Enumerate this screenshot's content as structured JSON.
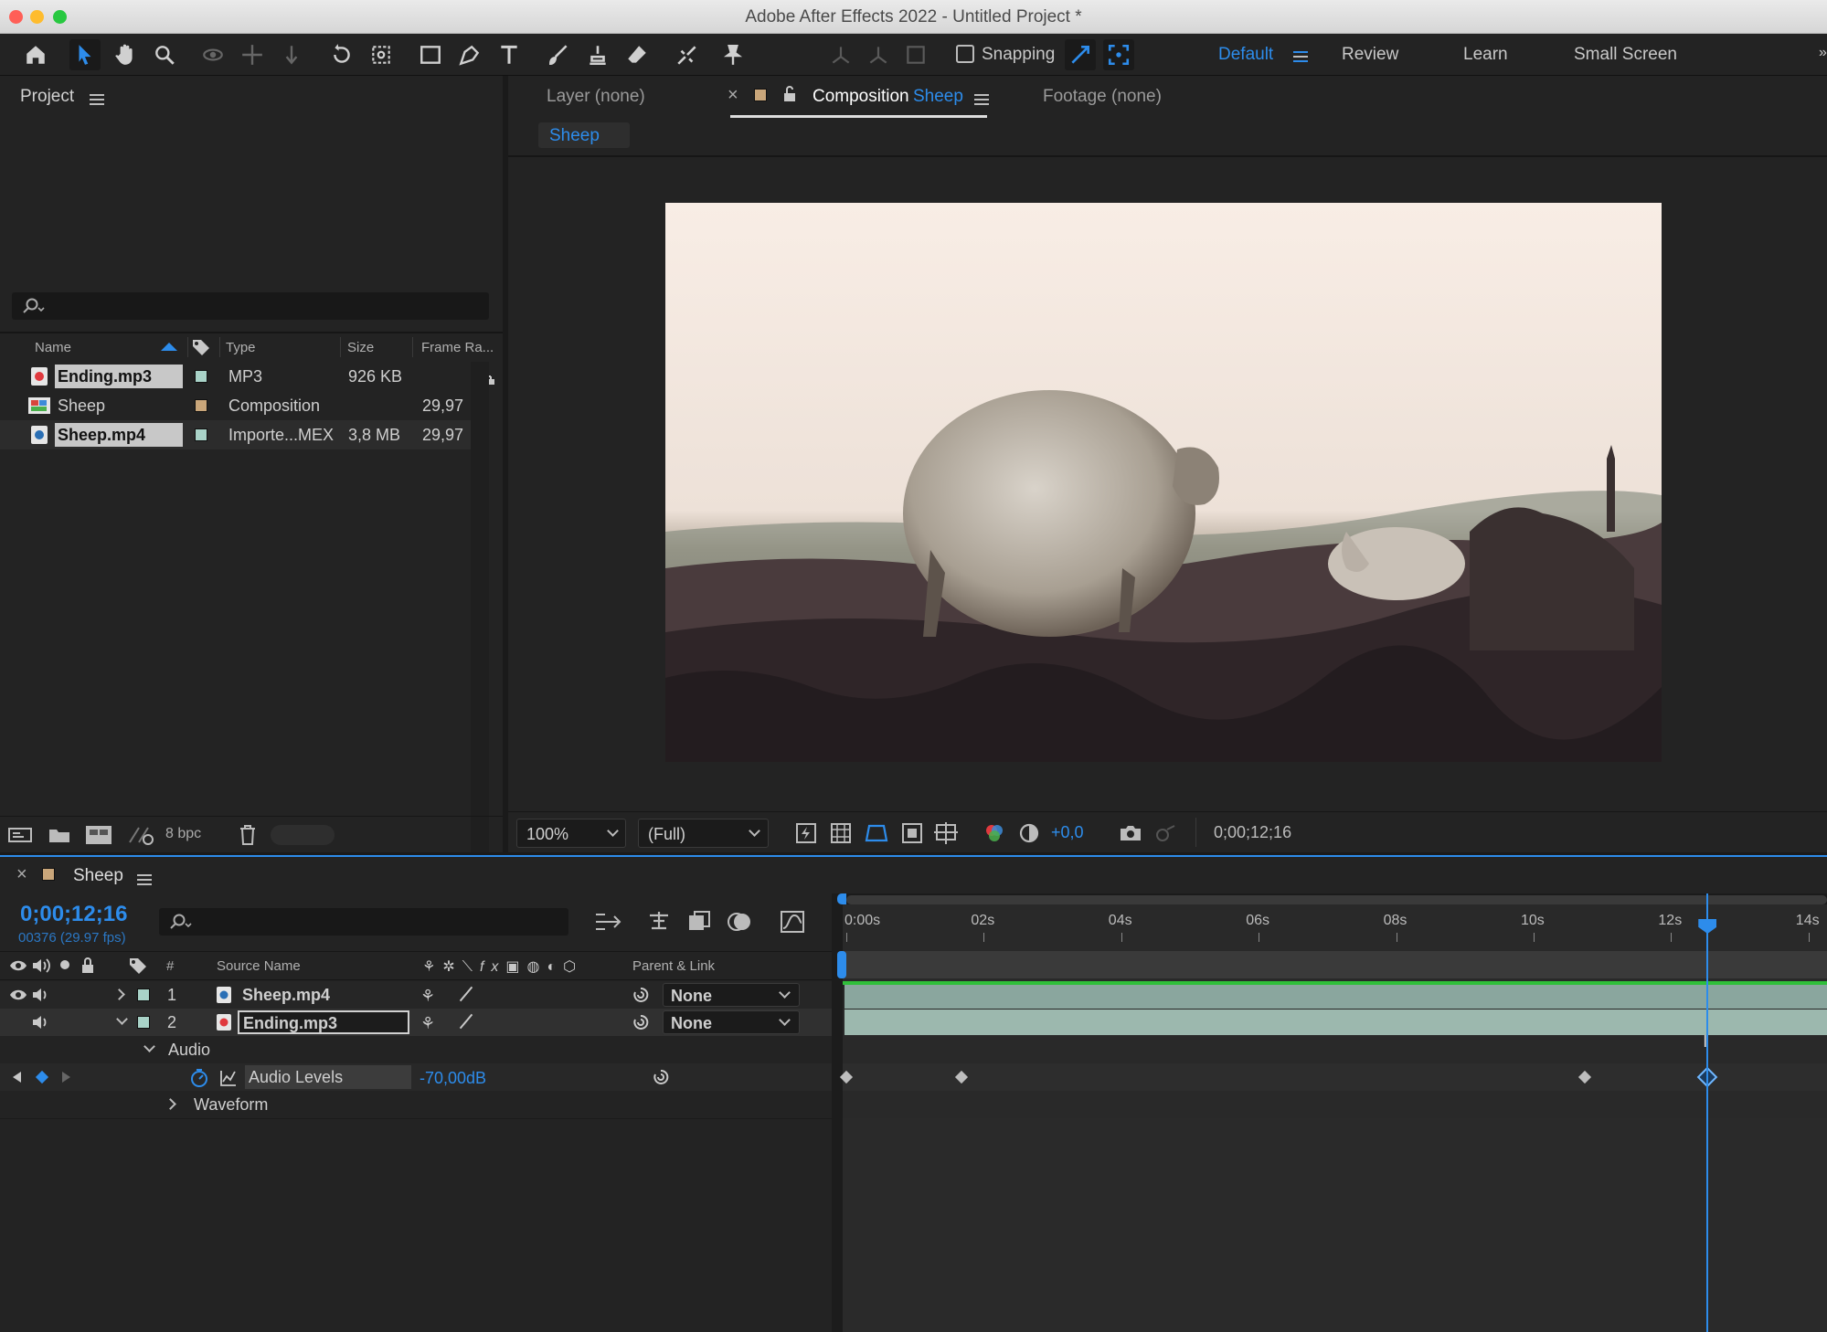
{
  "window": {
    "title": "Adobe After Effects 2022 - Untitled Project *"
  },
  "toolbar": {
    "snapping_label": "Snapping",
    "workspaces": [
      "Default",
      "Review",
      "Learn",
      "Small Screen"
    ]
  },
  "project": {
    "panel_title": "Project",
    "search_placeholder": "",
    "columns": [
      "Name",
      "Type",
      "Size",
      "Frame Ra..."
    ],
    "items": [
      {
        "name": "Ending.mp3",
        "type": "MP3",
        "size": "926 KB",
        "fps": "",
        "label_color": "#a9d3c8",
        "icon": "audio-file-icon"
      },
      {
        "name": "Sheep",
        "type": "Composition",
        "size": "",
        "fps": "29,97",
        "label_color": "#c9a67a",
        "icon": "composition-icon"
      },
      {
        "name": "Sheep.mp4",
        "type": "Importe...MEX",
        "size": "3,8 MB",
        "fps": "29,97",
        "label_color": "#a9d3c8",
        "icon": "video-file-icon"
      }
    ],
    "bpc_label": "8 bpc"
  },
  "viewer": {
    "tabs": {
      "layer": "Layer (none)",
      "composition_prefix": "Composition",
      "composition_name": "Sheep",
      "footage": "Footage (none)"
    },
    "breadcrumb": "Sheep",
    "zoom": "100%",
    "resolution": "(Full)",
    "exposure": "+0,0",
    "timecode": "0;00;12;16"
  },
  "timeline": {
    "tab": "Sheep",
    "timecode": "0;00;12;16",
    "frame_info": "00376 (29.97 fps)",
    "ruler": [
      "0:00s",
      "02s",
      "04s",
      "06s",
      "08s",
      "10s",
      "12s",
      "14s"
    ],
    "columns": {
      "num": "#",
      "source_name": "Source Name",
      "parent": "Parent & Link"
    },
    "layers": [
      {
        "num": "1",
        "name": "Sheep.mp4",
        "parent": "None"
      },
      {
        "num": "2",
        "name": "Ending.mp3",
        "parent": "None"
      }
    ],
    "audio_group": "Audio",
    "audio_levels_label": "Audio Levels",
    "audio_levels_value": "-70,00dB",
    "waveform_label": "Waveform",
    "playhead_seconds": 12.53,
    "keyframe_seconds": [
      0.0,
      1.67,
      10.75,
      12.53
    ]
  },
  "colors": {
    "accent": "#2d8ceb",
    "video_bar": "#8aa69e",
    "green_line": "#2fbf3a"
  }
}
